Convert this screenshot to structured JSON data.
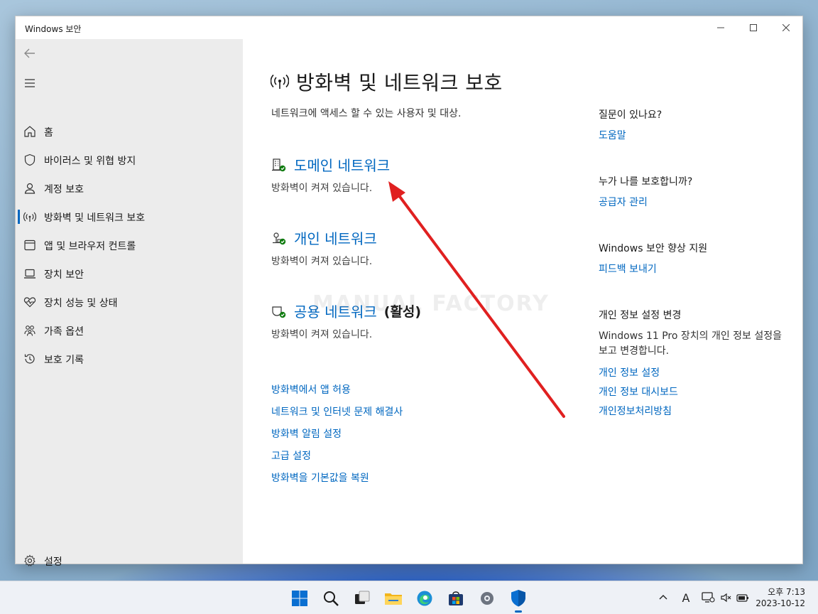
{
  "window": {
    "title": "Windows 보안"
  },
  "sidebar": {
    "items": [
      {
        "label": "홈"
      },
      {
        "label": "바이러스 및 위협 방지"
      },
      {
        "label": "계정 보호"
      },
      {
        "label": "방화벽 및 네트워크 보호"
      },
      {
        "label": "앱 및 브라우저 컨트롤"
      },
      {
        "label": "장치 보안"
      },
      {
        "label": "장치 성능 및 상태"
      },
      {
        "label": "가족 옵션"
      },
      {
        "label": "보호 기록"
      }
    ],
    "settings_label": "설정"
  },
  "main": {
    "title": "방화벽 및 네트워크 보호",
    "subtitle": "네트워크에 액세스 할 수 있는 사용자 및 대상.",
    "networks": [
      {
        "name": "도메인 네트워크",
        "status": "방화벽이 켜져 있습니다.",
        "tag": ""
      },
      {
        "name": "개인 네트워크",
        "status": "방화벽이 켜져 있습니다.",
        "tag": ""
      },
      {
        "name": "공용 네트워크",
        "status": "방화벽이 켜져 있습니다.",
        "tag": "(활성)"
      }
    ],
    "links": [
      "방화벽에서 앱 허용",
      "네트워크 및 인터넷 문제 해결사",
      "방화벽 알림 설정",
      "고급 설정",
      "방화벽을 기본값을 복원"
    ],
    "watermark": "MANUAL FACTORY"
  },
  "side": {
    "help_heading": "질문이 있나요?",
    "help_link": "도움말",
    "protect_heading": "누가 나를 보호합니까?",
    "protect_link": "공급자 관리",
    "improve_heading": "Windows 보안 향상 지원",
    "improve_link": "피드백 보내기",
    "privacy_heading": "개인 정보 설정 변경",
    "privacy_text": "Windows 11 Pro 장치의 개인 정보 설정을 보고 변경합니다.",
    "privacy_links": [
      "개인 정보 설정",
      "개인 정보 대시보드",
      "개인정보처리방침"
    ]
  },
  "taskbar": {
    "time": "오후 7:13",
    "date": "2023-10-12",
    "ime": "A"
  },
  "colors": {
    "accent": "#0067c0",
    "arrow": "#e02020"
  }
}
